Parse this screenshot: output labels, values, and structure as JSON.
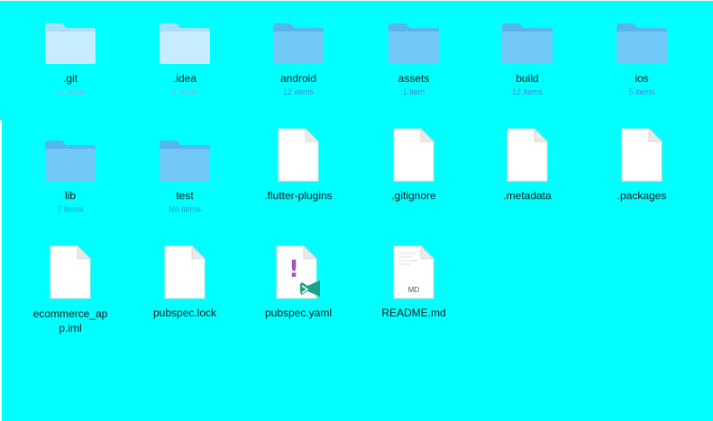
{
  "window": {
    "background_color": "#00ffff"
  },
  "items": [
    {
      "name": ".git",
      "count": "12 items",
      "kind": "folder-icon",
      "dim": true
    },
    {
      "name": ".idea",
      "count": "9 items",
      "kind": "folder-icon",
      "dim": true
    },
    {
      "name": "android",
      "count": "12 items",
      "kind": "folder-icon",
      "dim": false
    },
    {
      "name": "assets",
      "count": "1 item",
      "kind": "folder-icon",
      "dim": false
    },
    {
      "name": "build",
      "count": "12 items",
      "kind": "folder-icon",
      "dim": false
    },
    {
      "name": "ios",
      "count": "5 items",
      "kind": "folder-icon",
      "dim": false
    },
    {
      "name": "lib",
      "count": "7 items",
      "kind": "folder-icon",
      "dim": false
    },
    {
      "name": "test",
      "count": "No items",
      "kind": "folder-icon",
      "dim": false
    },
    {
      "name": ".flutter-plugins",
      "count": "",
      "kind": "file-icon"
    },
    {
      "name": ".gitignore",
      "count": "",
      "kind": "file-icon"
    },
    {
      "name": ".metadata",
      "count": "",
      "kind": "file-icon"
    },
    {
      "name": ".packages",
      "count": "",
      "kind": "file-icon"
    },
    {
      "name": "ecommerce_app.iml",
      "count": "",
      "kind": "file-icon"
    },
    {
      "name": "pubspec.lock",
      "count": "",
      "kind": "file-icon"
    },
    {
      "name": "pubspec.yaml",
      "count": "",
      "kind": "yaml-vscode-file-icon"
    },
    {
      "name": "README.md",
      "count": "",
      "kind": "markdown-file-icon",
      "badge": "MD"
    }
  ],
  "colors": {
    "folder_front": "#6ec6f5",
    "folder_back": "#5ab8ef",
    "folder_dim_front": "#bfe8fb",
    "folder_dim_back": "#aadff8",
    "count_text": "#3f8cd8",
    "yaml_mark": "#9b59b6",
    "vscode_mark": "#1aa38a"
  }
}
